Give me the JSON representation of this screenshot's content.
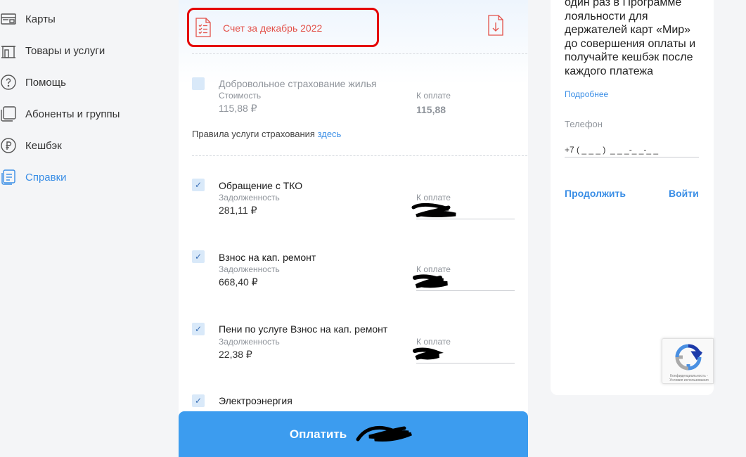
{
  "sidebar": {
    "items": [
      {
        "label": "Карты",
        "icon": "card-icon"
      },
      {
        "label": "Товары и услуги",
        "icon": "store-icon"
      },
      {
        "label": "Помощь",
        "icon": "help-icon"
      },
      {
        "label": "Абоненты и группы",
        "icon": "subscribers-icon"
      },
      {
        "label": "Кешбэк",
        "icon": "ruble-icon"
      },
      {
        "label": "Справки",
        "icon": "document-icon"
      }
    ],
    "active_index": 5,
    "accent_color": "#3a8ee6"
  },
  "invoice": {
    "title": "Счет за декабрь 2022",
    "highlight_color": "#e50000"
  },
  "services": [
    {
      "name": "Добровольное страхование жилья",
      "sub_label": "Стоимость",
      "amount": "115,88 ₽",
      "pay_label": "К оплате",
      "pay_value": "115,88",
      "checked": false
    },
    {
      "name": "Обращение с ТКО",
      "sub_label": "Задолженность",
      "amount": "281,11 ₽",
      "pay_label": "К оплате",
      "checked": true
    },
    {
      "name": "Взнос на кап. ремонт",
      "sub_label": "Задолженность",
      "amount": "668,40 ₽",
      "pay_label": "К оплате",
      "checked": true
    },
    {
      "name": "Пени по услуге Взнос на кап. ремонт",
      "sub_label": "Задолженность",
      "amount": "22,38 ₽",
      "pay_label": "К оплате",
      "checked": true
    },
    {
      "name": "Электроэнергия",
      "checked": true
    }
  ],
  "insurance_rules": {
    "text": "Правила услуги страхования",
    "link": "здесь"
  },
  "pay_button": {
    "label": "Оплатить",
    "color": "#3c9cef"
  },
  "promo": {
    "text": "один раз в Программе лояльности для держателей карт «Мир» до совершения оплаты и получайте кешбэк после каждого платежа",
    "more_link": "Подробнее"
  },
  "phone": {
    "label": "Телефон",
    "value": "+7 ( _ _ _ )  _ _ _-_ _-_ _"
  },
  "actions": {
    "continue": "Продолжить",
    "login": "Войти"
  },
  "recaptcha": {
    "text": "Конфиденциальность - Условия использования"
  }
}
